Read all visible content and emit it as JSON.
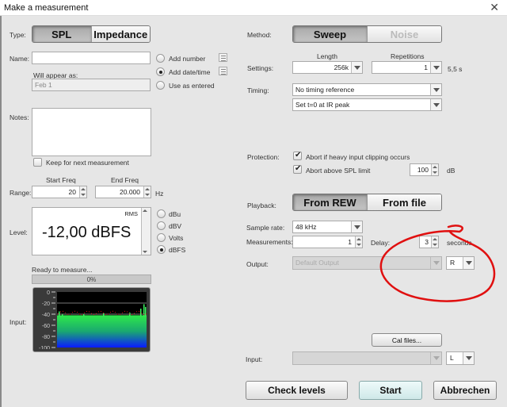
{
  "window": {
    "title": "Make a measurement",
    "close_icon": "close-icon"
  },
  "type": {
    "label": "Type:",
    "options": [
      "SPL",
      "Impedance"
    ],
    "selected": "SPL"
  },
  "name": {
    "label": "Name:",
    "value": "",
    "appear_label": "Will appear as:",
    "appear_value": "Feb 1",
    "options": [
      "Add number",
      "Add date/time",
      "Use as entered"
    ],
    "selected": "Add date/time"
  },
  "notes": {
    "label": "Notes:",
    "value": "",
    "keep_label": "Keep for next measurement",
    "keep_checked": false
  },
  "range": {
    "label": "Range:",
    "start_label": "Start Freq",
    "start_value": "20",
    "end_label": "End Freq",
    "end_value": "20.000",
    "unit": "Hz"
  },
  "level": {
    "label": "Level:",
    "mode": "RMS",
    "value": "-12,00 dBFS",
    "units": [
      "dBu",
      "dBV",
      "Volts",
      "dBFS"
    ],
    "selected_unit": "dBFS"
  },
  "status": {
    "text": "Ready to measure...",
    "progress_label": "0%",
    "progress": 0
  },
  "input_meter": {
    "label": "Input:",
    "scale": [
      "0",
      "-20",
      "-40",
      "-60",
      "-80",
      "-100"
    ],
    "level_db": -42,
    "peak_db": -37
  },
  "method": {
    "label": "Method:",
    "options": [
      "Sweep",
      "Noise"
    ],
    "selected": "Sweep"
  },
  "settings": {
    "label": "Settings:",
    "length_label": "Length",
    "length_value": "256k",
    "reps_label": "Repetitions",
    "reps_value": "1",
    "duration": "5,5 s"
  },
  "timing": {
    "label": "Timing:",
    "reference": "No timing reference",
    "t0": "Set t=0 at IR peak"
  },
  "protection": {
    "label": "Protection:",
    "clip_label": "Abort if heavy input clipping occurs",
    "clip_checked": true,
    "spl_label": "Abort above SPL limit",
    "spl_checked": true,
    "spl_value": "100",
    "spl_unit": "dB"
  },
  "playback": {
    "label": "Playback:",
    "options": [
      "From REW",
      "From file"
    ],
    "selected": "From REW"
  },
  "sample_rate": {
    "label": "Sample rate:",
    "value": "48 kHz"
  },
  "measurements": {
    "label": "Measurements:",
    "value": "1",
    "delay_label": "Delay:",
    "delay_value": "3",
    "delay_unit": "seconds"
  },
  "output": {
    "label": "Output:",
    "device": "Default Output",
    "channel": "R"
  },
  "cal_files": {
    "label": "Cal files..."
  },
  "input": {
    "label": "Input:",
    "device": "",
    "channel": "L"
  },
  "actions": {
    "check_levels": "Check levels",
    "start": "Start",
    "cancel": "Abbrechen"
  },
  "annotation": {
    "color": "#e01010"
  }
}
